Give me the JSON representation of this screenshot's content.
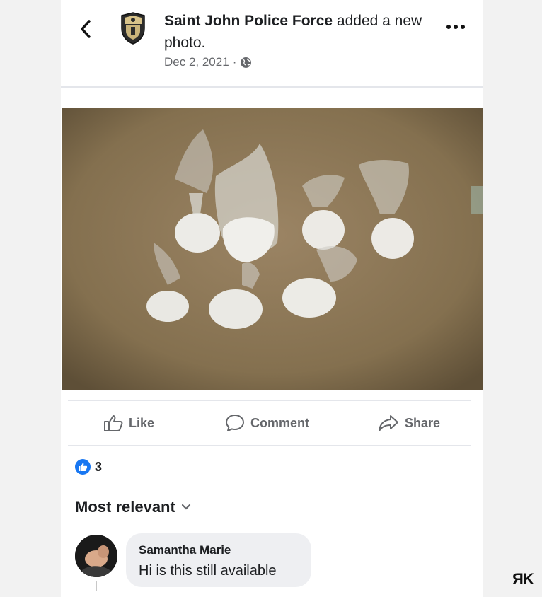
{
  "header": {
    "page_name": "Saint John Police Force",
    "action_text": "added a new photo.",
    "date": "Dec 2, 2021",
    "separator": "·",
    "privacy_icon": "globe-icon",
    "back_icon": "chevron-left-icon",
    "more_icon": "ellipsis-icon"
  },
  "actions": {
    "like_label": "Like",
    "comment_label": "Comment",
    "share_label": "Share"
  },
  "reactions": {
    "count": "3",
    "icon": "like-badge-icon"
  },
  "comments": {
    "sort_label": "Most relevant",
    "items": [
      {
        "author": "Samantha Marie",
        "text": "Hi is this still available"
      }
    ]
  },
  "watermark": "ЯK",
  "colors": {
    "accent": "#1877f2",
    "muted_text": "#65676b",
    "bubble": "#eeeff2",
    "photo_background": "#8b7559"
  }
}
